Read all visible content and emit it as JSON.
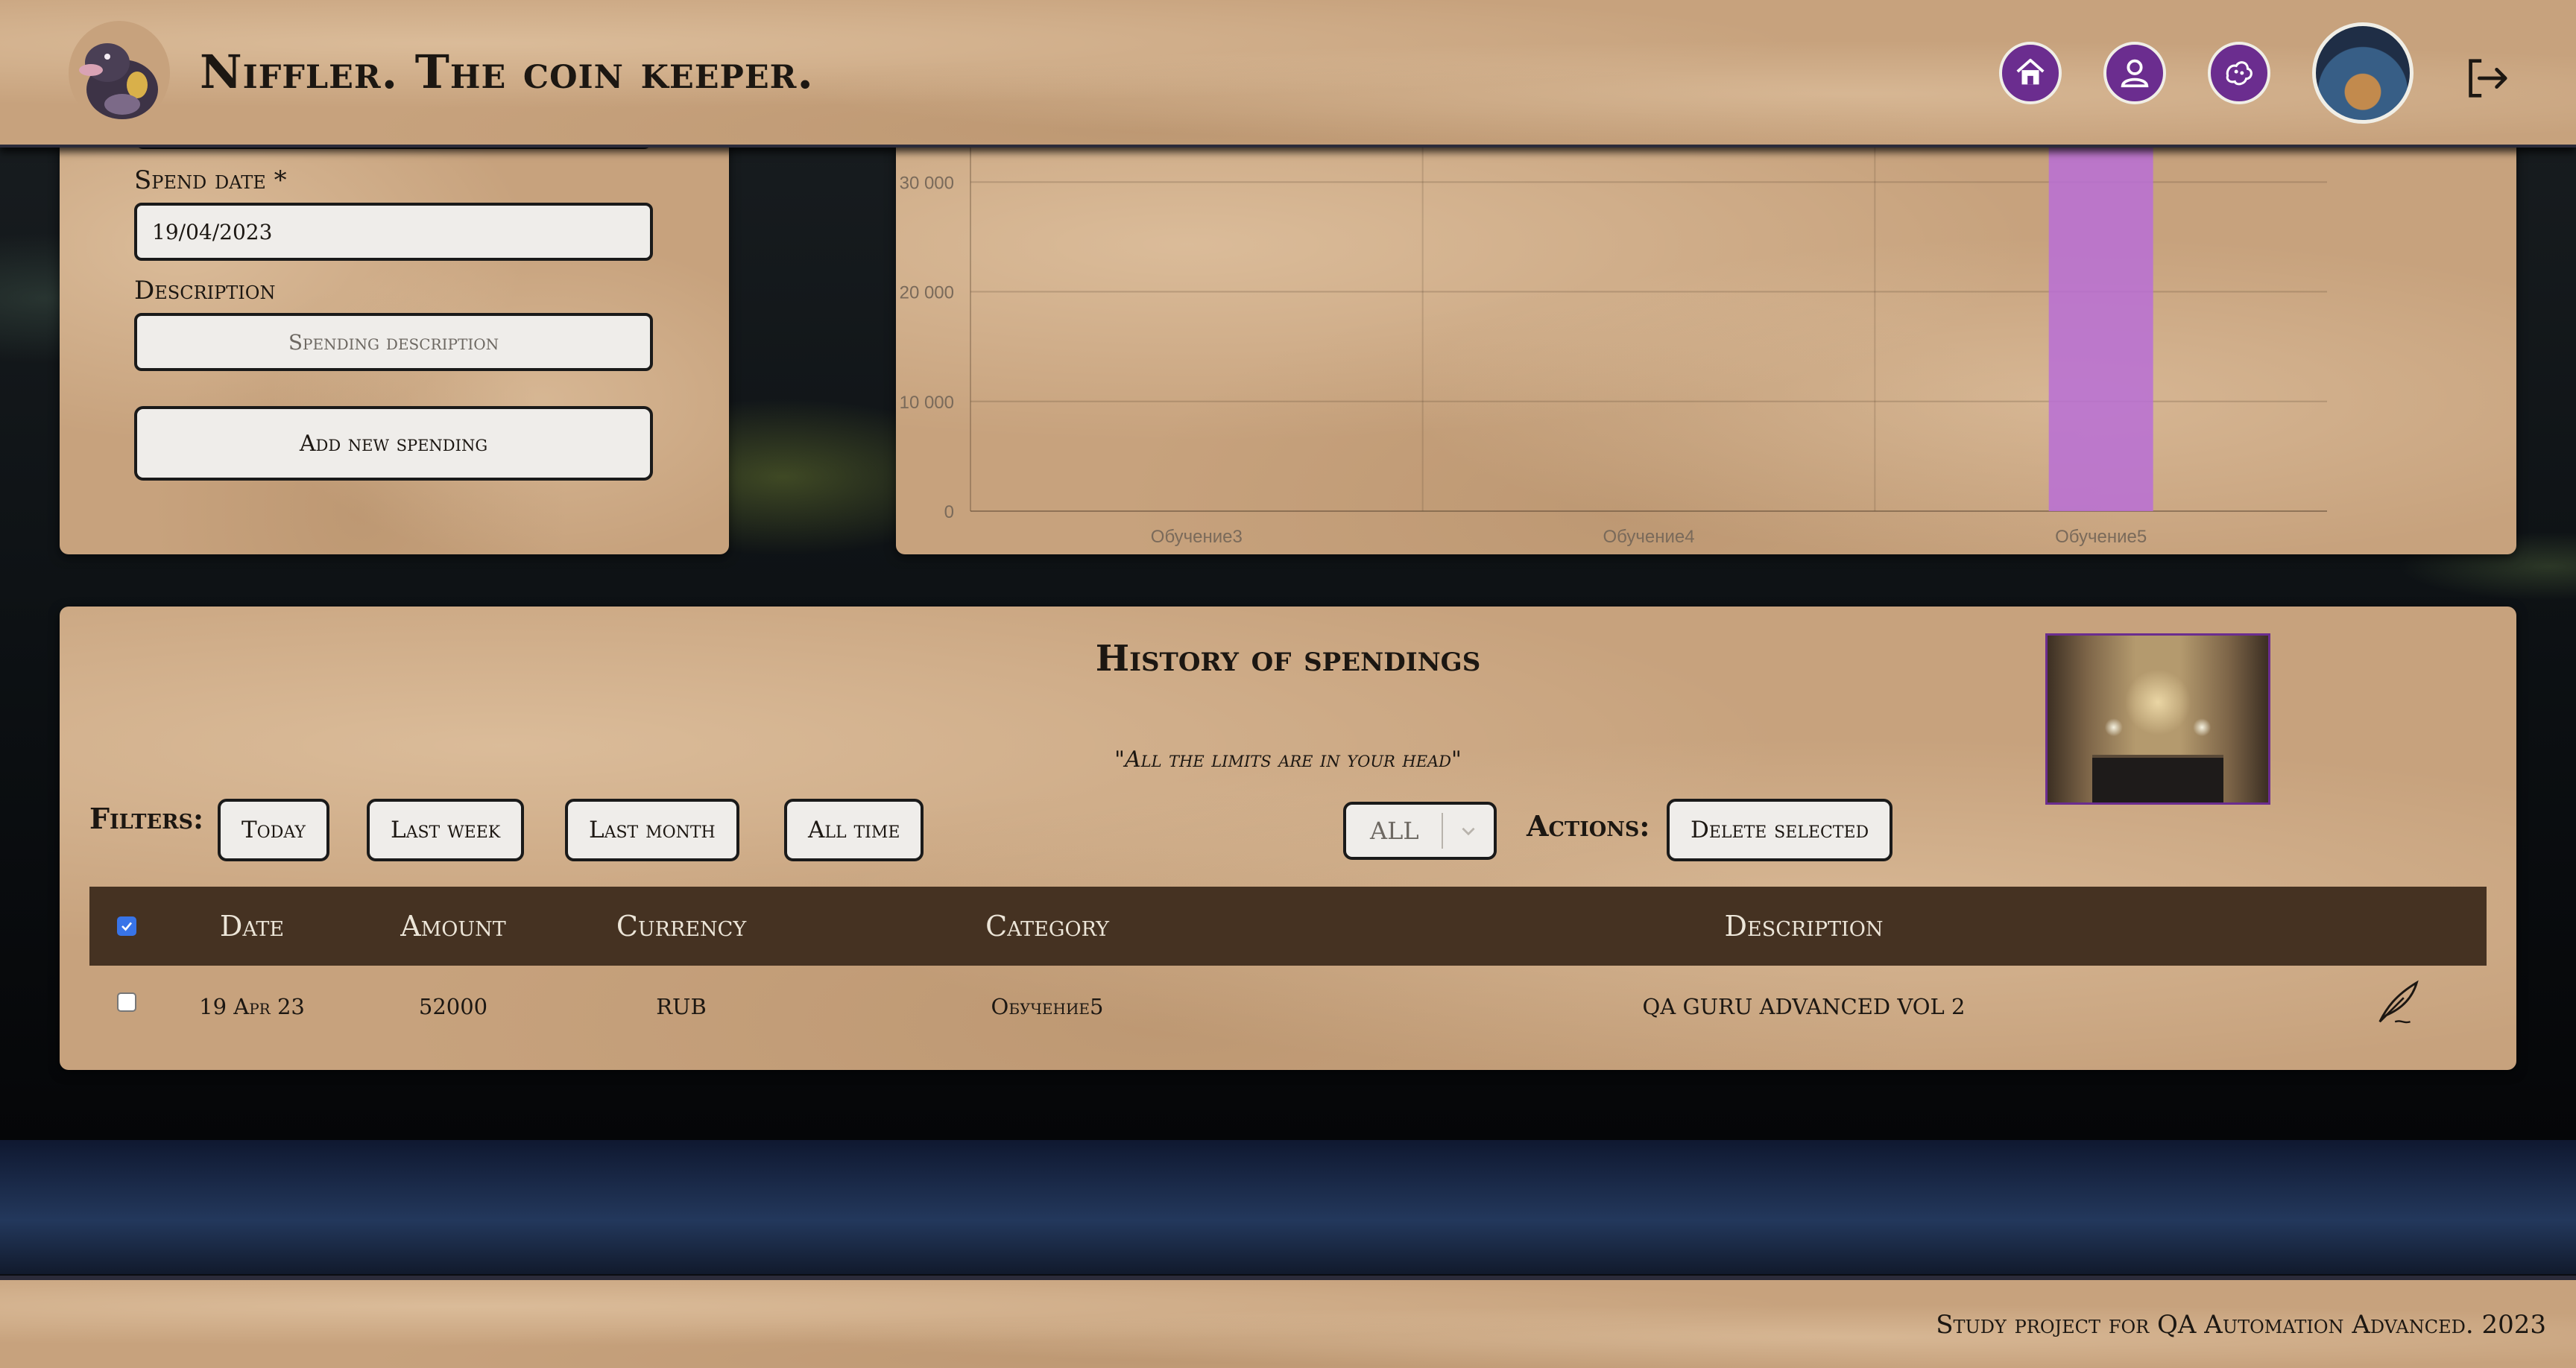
{
  "header": {
    "title": "Niffler. The coin keeper.",
    "nav": [
      {
        "icon": "home-icon"
      },
      {
        "icon": "user-icon"
      },
      {
        "icon": "friends-icon"
      }
    ],
    "avatar": "avatar",
    "logout_icon": "logout-icon"
  },
  "spending_form": {
    "date_label": "Spend date *",
    "date_value": "19/04/2023",
    "description_label": "Description",
    "description_placeholder": "Spending description",
    "add_button": "Add new spending"
  },
  "chart_data": {
    "type": "bar",
    "categories": [
      "Обучение3",
      "Обучение4",
      "Обучение5"
    ],
    "values": [
      0,
      0,
      52000
    ],
    "y_ticks": [
      "0",
      "10 000",
      "20 000",
      "30 000"
    ],
    "ylim": [
      0,
      36000
    ],
    "bar_color": "#b86ed6",
    "grid": true
  },
  "history": {
    "title": "History of spendings",
    "quote": "\"All the limits are in your head\"",
    "filters_label": "Filters:",
    "filters": [
      "Today",
      "Last week",
      "Last month",
      "All time"
    ],
    "currency_select": "ALL",
    "actions_label": "Actions:",
    "delete_button": "Delete selected",
    "columns": [
      "Date",
      "Amount",
      "Currency",
      "Category",
      "Description"
    ],
    "rows": [
      {
        "date": "19 Apr 23",
        "amount": "52000",
        "currency": "RUB",
        "category": "Обучение5",
        "description": "QA GURU ADVANCED VOL 2"
      }
    ]
  },
  "footer": {
    "text": "Study project for QA Automation Advanced. 2023"
  },
  "colors": {
    "paper": "#c7a27d",
    "accent": "#6b2d8f",
    "table_header": "#453222"
  }
}
